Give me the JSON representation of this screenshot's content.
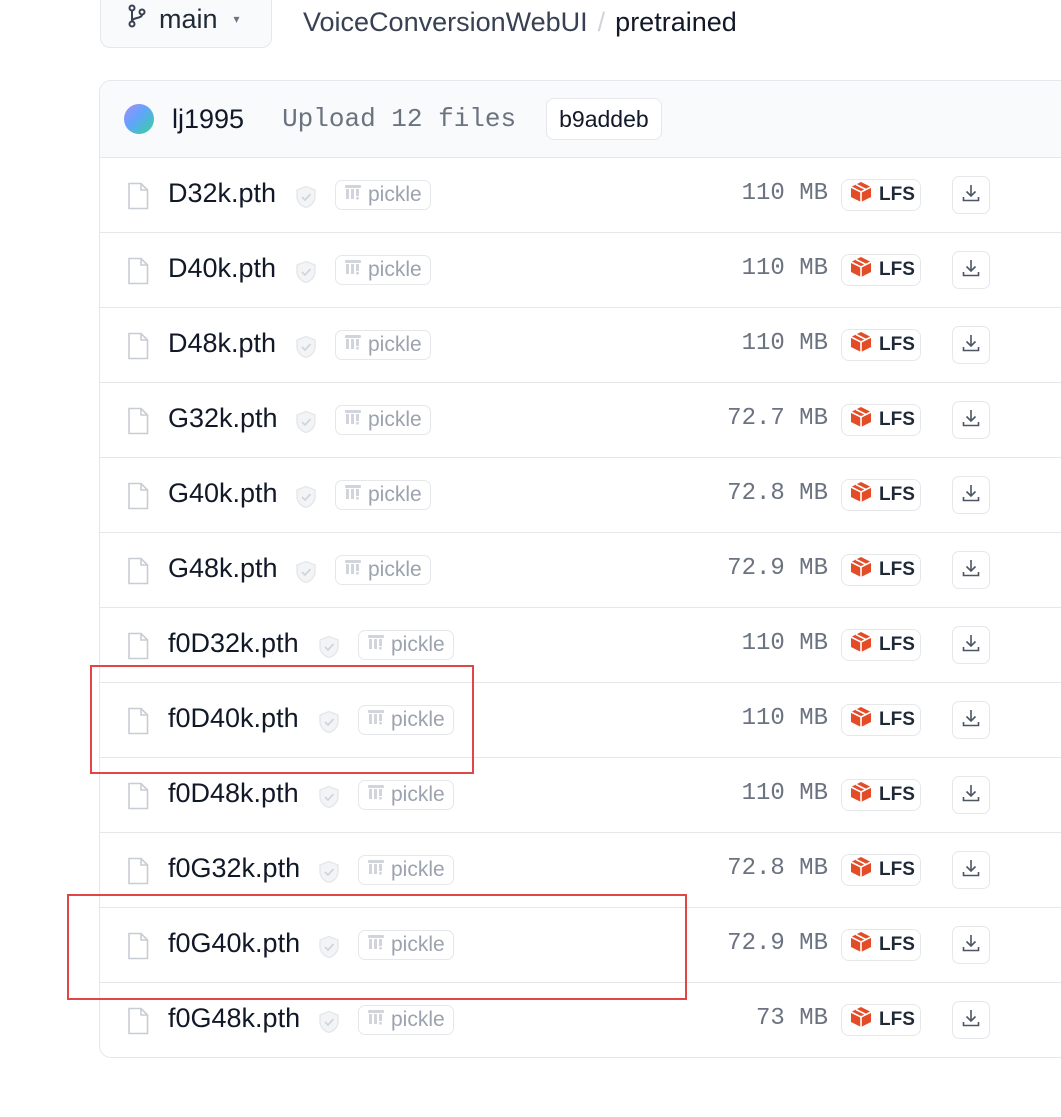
{
  "branch": {
    "icon": "git-branch-icon",
    "label": "main",
    "chevron": "▾"
  },
  "breadcrumb": {
    "repo": "VoiceConversionWebUI",
    "separator": "/",
    "folder": "pretrained"
  },
  "commit": {
    "author": "lj1995",
    "message": "Upload 12 files",
    "hash": "b9addeb"
  },
  "files": [
    {
      "name": "D32k.pth",
      "badge": "pickle",
      "size": "110 MB",
      "storage": "LFS"
    },
    {
      "name": "D40k.pth",
      "badge": "pickle",
      "size": "110 MB",
      "storage": "LFS"
    },
    {
      "name": "D48k.pth",
      "badge": "pickle",
      "size": "110 MB",
      "storage": "LFS"
    },
    {
      "name": "G32k.pth",
      "badge": "pickle",
      "size": "72.7 MB",
      "storage": "LFS"
    },
    {
      "name": "G40k.pth",
      "badge": "pickle",
      "size": "72.8 MB",
      "storage": "LFS"
    },
    {
      "name": "G48k.pth",
      "badge": "pickle",
      "size": "72.9 MB",
      "storage": "LFS"
    },
    {
      "name": "f0D32k.pth",
      "badge": "pickle",
      "size": "110 MB",
      "storage": "LFS"
    },
    {
      "name": "f0D40k.pth",
      "badge": "pickle",
      "size": "110 MB",
      "storage": "LFS",
      "highlighted": true
    },
    {
      "name": "f0D48k.pth",
      "badge": "pickle",
      "size": "110 MB",
      "storage": "LFS"
    },
    {
      "name": "f0G32k.pth",
      "badge": "pickle",
      "size": "72.8 MB",
      "storage": "LFS"
    },
    {
      "name": "f0G40k.pth",
      "badge": "pickle",
      "size": "72.9 MB",
      "storage": "LFS",
      "highlighted": true
    },
    {
      "name": "f0G48k.pth",
      "badge": "pickle",
      "size": "73 MB",
      "storage": "LFS"
    }
  ],
  "colors": {
    "lfs_red": "#e34c26",
    "highlight": "#e04646",
    "border": "#e5e7eb"
  }
}
